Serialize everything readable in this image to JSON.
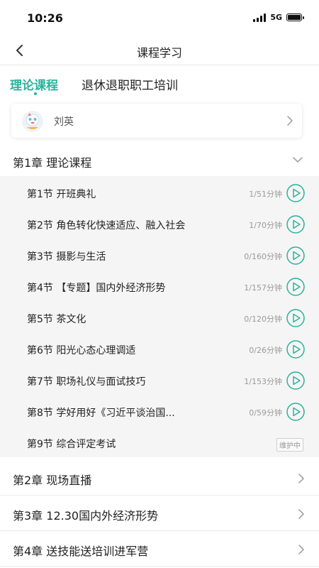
{
  "status": {
    "time": "10:26",
    "network": "5G"
  },
  "nav": {
    "title": "课程学习"
  },
  "tabs": [
    {
      "label": "理论课程",
      "active": true
    },
    {
      "label": "退休退职职工培训",
      "active": false
    }
  ],
  "user": {
    "name": "刘英",
    "avatar_icon": "cartoon-avatar-icon"
  },
  "colors": {
    "accent": "#2bb39b",
    "text": "#222222",
    "muted": "#999999",
    "list_bg": "#f5f5f5"
  },
  "chapters": [
    {
      "title": "第1章  理论课程",
      "expanded": true,
      "sections": [
        {
          "title": "第1节  开班典礼",
          "meta": "1/51分钟"
        },
        {
          "title": "第2节  角色转化快速适应、融入社会",
          "meta": "1/70分钟"
        },
        {
          "title": "第3节  摄影与生活",
          "meta": "0/160分钟"
        },
        {
          "title": "第4节  【专题】国内外经济形势",
          "meta": "1/157分钟"
        },
        {
          "title": "第5节  茶文化",
          "meta": "0/120分钟"
        },
        {
          "title": "第6节  阳光心态心理调适",
          "meta": "0/26分钟"
        },
        {
          "title": "第7节  职场礼仪与面试技巧",
          "meta": "1/153分钟"
        },
        {
          "title": "第8节  学好用好《习近平谈治国...",
          "meta": "0/59分钟"
        },
        {
          "title": "第9节  综合评定考试",
          "badge": "维护中"
        }
      ]
    },
    {
      "title": "第2章  现场直播",
      "expanded": false
    },
    {
      "title": "第3章  12.30国内外经济形势",
      "expanded": false
    },
    {
      "title": "第4章  送技能送培训进军营",
      "expanded": false
    }
  ]
}
